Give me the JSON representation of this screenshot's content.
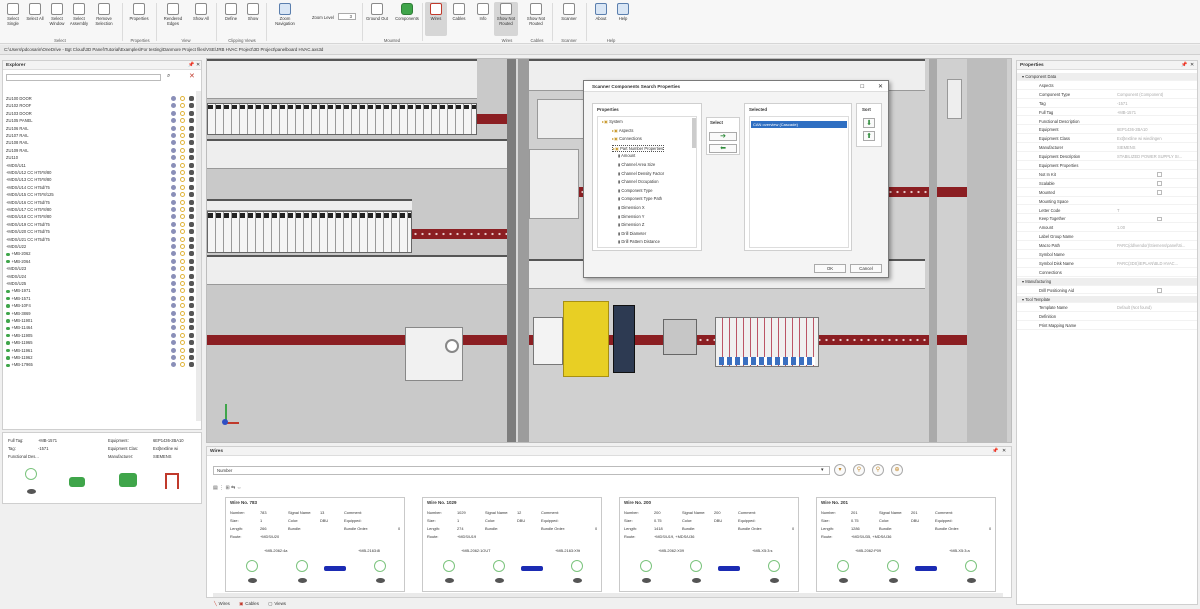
{
  "ribbon": {
    "buttons": [
      {
        "label": "Select Single"
      },
      {
        "label": "Select All"
      },
      {
        "label": "Select Window"
      },
      {
        "label": "Select Assembly"
      },
      {
        "label": "Remove Selection"
      },
      {
        "label": "Properties"
      },
      {
        "label": "Rendered Edges"
      },
      {
        "label": "Show All"
      },
      {
        "label": "Define"
      },
      {
        "label": "Show"
      },
      {
        "label": "Zoom Navigation"
      },
      {
        "label": "Ground Out"
      },
      {
        "label": "Components"
      },
      {
        "label": "Wires"
      },
      {
        "label": "Cables"
      },
      {
        "label": "Info"
      },
      {
        "label": "Show Not Routed"
      },
      {
        "label": "Show Not Routed"
      },
      {
        "label": "Scanner"
      },
      {
        "label": "About"
      },
      {
        "label": "Help"
      }
    ],
    "zoom_label": "Zoom Level",
    "zoom_value": "3",
    "groups": [
      "Select",
      "Properties",
      "View",
      "Clipping Views",
      "Mounted",
      "Wires",
      "Cables",
      "Scanner",
      "Help"
    ]
  },
  "path": "C:\\Users\\pdcosarin\\OneDrive - Bgt Cloud\\3D Panel\\Tutorial\\Examples\\For testing\\Danmore Project files\\VSE\\JRB HVAC Project\\3D Project\\panelboard HVAC.axs3d",
  "explorer": {
    "title": "Explorer",
    "items": [
      "ZU100 DOOR",
      "ZU102 ROOF",
      "ZU103 DOOR",
      "ZU105 PANEL",
      "ZU106 RAIL",
      "ZU107 RAIL",
      "ZU108 RAIL",
      "ZU109 RAIL",
      "ZU110",
      "+MDS/U11",
      "+MDS/U12 CC H75*8/80",
      "+MDS/U13 CC H75*8/80",
      "+MDS/U14 CC H75d/75",
      "+MDS/U15 CC H75*8/125",
      "+MDS/U16 CC H75d/75",
      "+MDS/U17 CC H75*8/80",
      "+MDS/U18 CC H75*8/80",
      "+MDS/U19 CC H75d/75",
      "+MDS/U20 CC H75d/75",
      "+MDS/U21 CC H75d/75",
      "+MDS/U22",
      "+MB-2062",
      "+MB-2064",
      "+MDS/U23",
      "+MDS/U24",
      "+MDS/U25",
      "+MB-1971",
      "+MB-1571",
      "+MB-10F4",
      "+MB-3869",
      "+MB-11901",
      "+MB-11464",
      "+MB-11905",
      "+MB-11965",
      "+MB-11961",
      "+MB-11962",
      "+MB-17965"
    ],
    "details": {
      "full_tag_label": "Full Tag:",
      "full_tag": "+MB-1571",
      "tag_label": "Tag:",
      "tag": "-1571",
      "func_desc_label": "Functional Des...",
      "equipment_label": "Equipment:",
      "equipment": "6EP1436-2BA10",
      "equip_class_label": "Equipment Clas:",
      "equip_class": "Ext[textline wi",
      "manufacturer_label": "Manufacturer:",
      "manufacturer": "SIEMENS"
    }
  },
  "dialog": {
    "title": "Scanner Components Search Properties",
    "properties_header": "Properties",
    "select_header": "Select",
    "selected_header": "Selected",
    "sort_header": "Sort",
    "tree": [
      "System",
      "Aspects",
      "Connections",
      "Part Number Properties",
      "Amount",
      "Channel Area Size",
      "Channel Density Factor",
      "Channel Occupation",
      "Component Type",
      "Component Type Path",
      "Dimension X",
      "Dimension Y",
      "Dimension Z",
      "Drill Diameter",
      "Drill Pattern Distance"
    ],
    "selected_items": [
      "CAN overview (Cascade)"
    ],
    "ok": "OK",
    "cancel": "Cancel"
  },
  "properties": {
    "title": "Properties",
    "rows": [
      {
        "k": "Component Data",
        "v": "",
        "cat": true
      },
      {
        "k": "Aspects",
        "v": "",
        "cat": false
      },
      {
        "k": "Component Type",
        "v": "Component (Component)",
        "cat": false
      },
      {
        "k": "Tag",
        "v": "-1571",
        "cat": false
      },
      {
        "k": "Full Tag",
        "v": "+MB-1571",
        "cat": false
      },
      {
        "k": "Functional Description",
        "v": "",
        "cat": false
      },
      {
        "k": "Equipment",
        "v": "6EP1436-2BA10",
        "cat": false
      },
      {
        "k": "Equipment Class",
        "v": "Ext[textline wi wiedingen",
        "cat": false
      },
      {
        "k": "Manufacturer",
        "v": "SIEMENS",
        "cat": false
      },
      {
        "k": "Equipment Description",
        "v": "STABILIZED POWER SUPPLY SI...",
        "cat": false
      },
      {
        "k": "Equipment Properties",
        "v": "",
        "cat": false
      },
      {
        "k": "Not In Kit",
        "v": "",
        "cat": false,
        "check": true
      },
      {
        "k": "Scalable",
        "v": "",
        "cat": false,
        "check": true
      },
      {
        "k": "Mounted",
        "v": "",
        "cat": false,
        "check": true
      },
      {
        "k": "Mounting Space",
        "v": "",
        "cat": false
      },
      {
        "k": "Letter Code",
        "v": "T",
        "cat": false
      },
      {
        "k": "Keep Together",
        "v": "",
        "cat": false,
        "check": true
      },
      {
        "k": "Amount",
        "v": "1.00",
        "cat": false
      },
      {
        "k": "Label Group Name",
        "v": "",
        "cat": false
      },
      {
        "k": "Macro Path",
        "v": "PARC(dd\\vendor)\\Siemens\\panel\\Si...",
        "cat": false
      },
      {
        "k": "Symbol Name",
        "v": "",
        "cat": false
      },
      {
        "k": "Symbol Disk Name",
        "v": "PARC(3DS)\\EPLAN\\BLD HVAC...",
        "cat": false
      },
      {
        "k": "Connections",
        "v": "",
        "cat": false
      },
      {
        "k": "Manufacturing",
        "v": "",
        "cat": true
      },
      {
        "k": "Drill Positioning Aid",
        "v": "",
        "cat": false,
        "check": true
      },
      {
        "k": "Tool Template",
        "v": "",
        "cat": true
      },
      {
        "k": "Template Name",
        "v": "Default (Not found)",
        "cat": false
      },
      {
        "k": "Definition",
        "v": "",
        "cat": false
      },
      {
        "k": "Print Mapping Name",
        "v": "",
        "cat": false
      }
    ]
  },
  "wires": {
    "title": "Wires",
    "filter": "Number",
    "cards": [
      {
        "title": "Wire No. 783",
        "number": "783",
        "size": "1",
        "length": "266",
        "route": "+MDS/U20",
        "signal": "13",
        "color": "DBU",
        "bundle": "",
        "comment": "",
        "equipped": "",
        "bundle_order": "0",
        "from": "+MB-2062:4a",
        "to": "+MB-2163:8l"
      },
      {
        "title": "Wire No. 1029",
        "number": "1029",
        "size": "1",
        "length": "274",
        "route": "+MDS/U19",
        "signal": "12",
        "color": "DBU",
        "bundle": "",
        "comment": "",
        "equipped": "",
        "bundle_order": "0",
        "from": "+MB-2062:1OUT",
        "to": "+MB-2163:X9t"
      },
      {
        "title": "Wire No. 200",
        "number": "200",
        "size": "0.75",
        "length": "1418",
        "route": "+MDS/U19, +MDS/U36",
        "signal": "200",
        "color": "DBU",
        "bundle": "",
        "comment": "",
        "equipped": "",
        "bundle_order": "0",
        "from": "+MB-2062:X09",
        "to": "+MB-X5:3:s"
      },
      {
        "title": "Wire No. 201",
        "number": "201",
        "size": "0.75",
        "length": "1286",
        "route": "+MDS/U35, +MDS/U36",
        "signal": "201",
        "color": "DBU",
        "bundle": "",
        "comment": "",
        "equipped": "",
        "bundle_order": "0",
        "from": "+MB-2062:P09",
        "to": "+MB-X5:3:a"
      }
    ],
    "labels": {
      "number": "Number:",
      "size": "Size:",
      "length": "Length:",
      "route": "Route:",
      "signal": "Signal Name:",
      "color": "Color:",
      "bundle": "Bundle:",
      "comment": "Comment:",
      "equipped": "Equipped:",
      "bundle_order": "Bundle Order:"
    }
  },
  "bottom_tabs": [
    "Wires",
    "Cables",
    "Views"
  ]
}
